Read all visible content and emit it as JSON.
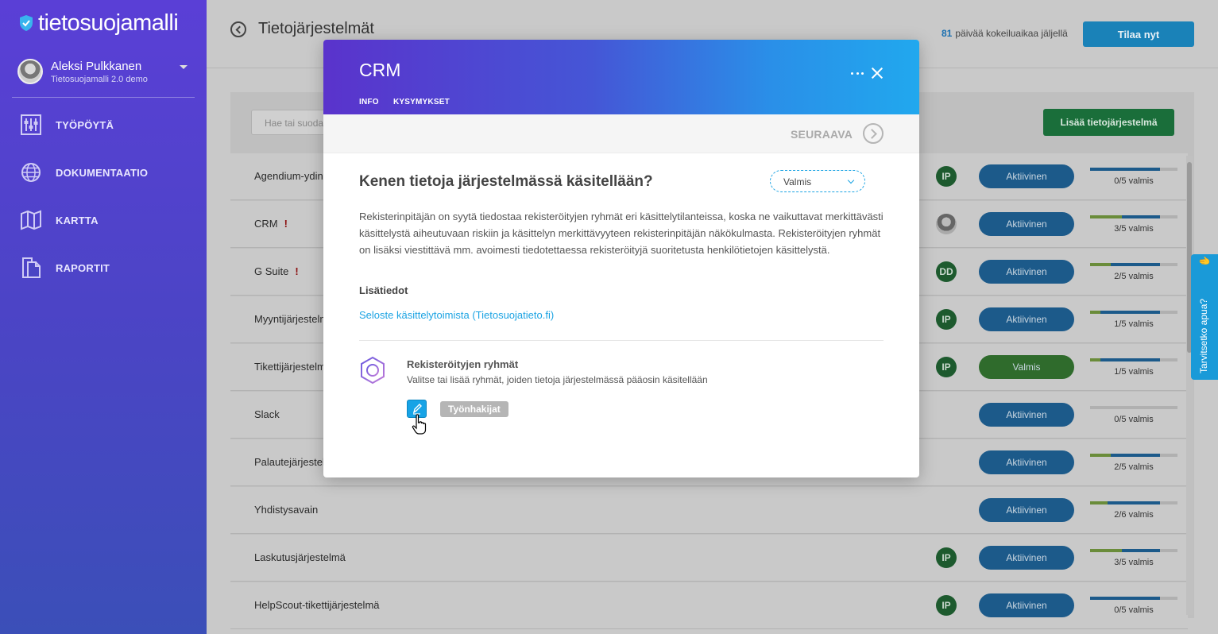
{
  "app": {
    "brand": "tietosuojamalli"
  },
  "user": {
    "name": "Aleksi Pulkkanen",
    "org": "Tietosuojamalli 2.0 demo"
  },
  "sidebar": {
    "items": [
      {
        "label": "TYÖPÖYTÄ",
        "icon": "sliders-icon"
      },
      {
        "label": "DOKUMENTAATIO",
        "icon": "globe-icon"
      },
      {
        "label": "KARTTA",
        "icon": "map-icon"
      },
      {
        "label": "RAPORTIT",
        "icon": "documents-icon"
      }
    ]
  },
  "header": {
    "title": "Tietojärjestelmät",
    "trial_days": "81",
    "trial_text": "päivää kokeiluaikaa jäljellä",
    "order_label": "Tilaa nyt"
  },
  "list": {
    "search_placeholder": "Hae tai suodata",
    "add_label": "Lisää tietojärjestelmä",
    "rows": [
      {
        "name": "Agendium-ydin",
        "warn": "",
        "owner": "IP",
        "status": "Aktiivinen",
        "progress": "0/5 valmis",
        "done": 0,
        "total": 5
      },
      {
        "name": "CRM",
        "warn": "!",
        "owner": "",
        "status": "Aktiivinen",
        "progress": "3/5 valmis",
        "done": 3,
        "total": 5
      },
      {
        "name": "G Suite",
        "warn": "!",
        "owner": "DD",
        "status": "Aktiivinen",
        "progress": "2/5 valmis",
        "done": 2,
        "total": 5
      },
      {
        "name": "Myyntijärjestelmä",
        "warn": "",
        "owner": "IP",
        "status": "Aktiivinen",
        "progress": "1/5 valmis",
        "done": 1,
        "total": 5
      },
      {
        "name": "Tikettijärjestelmä",
        "warn": "",
        "owner": "IP",
        "status": "Valmis",
        "progress": "1/5 valmis",
        "done": 1,
        "total": 5
      },
      {
        "name": "Slack",
        "warn": "",
        "owner": "",
        "status": "Aktiivinen",
        "progress": "0/5 valmis",
        "done": 0,
        "total": 5
      },
      {
        "name": "Palautejärjestelmä",
        "warn": "",
        "owner": "",
        "status": "Aktiivinen",
        "progress": "2/5 valmis",
        "done": 2,
        "total": 5
      },
      {
        "name": "Yhdistysavain",
        "warn": "",
        "owner": "",
        "status": "Aktiivinen",
        "progress": "2/6 valmis",
        "done": 2,
        "total": 6
      },
      {
        "name": "Laskutusjärjestelmä",
        "warn": "",
        "owner": "IP",
        "status": "Aktiivinen",
        "progress": "3/5 valmis",
        "done": 3,
        "total": 5
      },
      {
        "name": "HelpScout-tikettijärjestelmä",
        "warn": "",
        "owner": "IP",
        "status": "Aktiivinen",
        "progress": "0/5 valmis",
        "done": 0,
        "total": 5
      }
    ]
  },
  "help": {
    "label": "Tarvitsetko apua?"
  },
  "modal": {
    "title": "CRM",
    "tabs": [
      "INFO",
      "KYSYMYKSET"
    ],
    "next_label": "SEURAAVA",
    "question": "Kenen tietoja järjestelmässä käsitellään?",
    "status_value": "Valmis",
    "description": "Rekisterinpitäjän on syytä tiedostaa rekisteröityjen ryhmät eri käsittelytilanteissa, koska ne vaikuttavat merkittävästi käsittelystä aiheutuvaan riskiin ja käsittelyn merkittävyyteen rekisterinpitäjän näkökulmasta. Rekisteröityjen ryhmät on lisäksi viestittävä mm. avoimesti tiedotettaessa rekisteröityjä suoritetusta henkilötietojen käsittelystä.",
    "more_info_title": "Lisätiedot",
    "link_label": "Seloste käsittelytoimista (Tietosuojatieto.fi)",
    "field_title": "Rekisteröityjen ryhmät",
    "field_desc": "Valitse tai lisää ryhmät, joiden tietoja järjestelmässä pääosin käsitellään",
    "tags": [
      "Työnhakijat"
    ]
  },
  "colors": {
    "accent": "#1ba3e3",
    "brand_purple": "#5a33cc",
    "active_status": "#1c5a8a",
    "done_status": "#2f6b2c"
  }
}
